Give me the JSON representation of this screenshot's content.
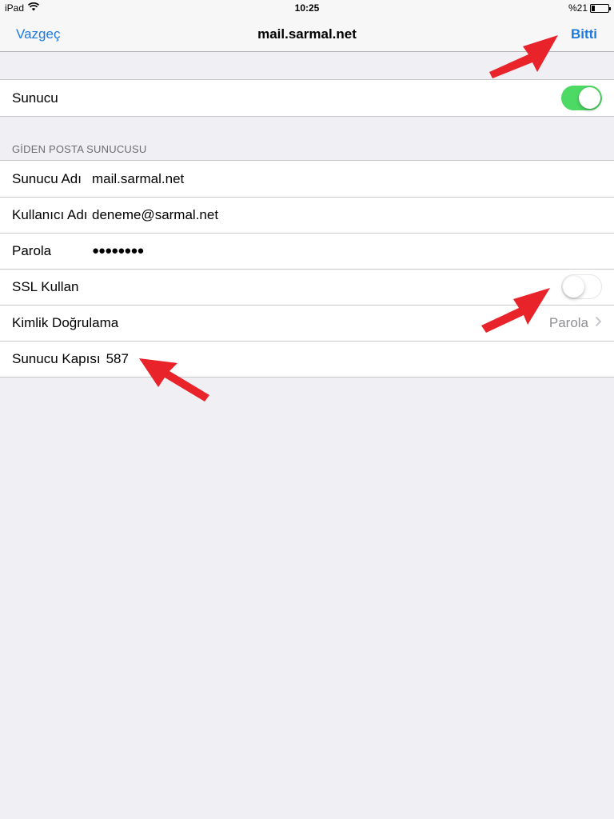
{
  "status_bar": {
    "device": "iPad",
    "time": "10:25",
    "battery_text": "%21",
    "battery_fraction": 0.21,
    "wifi_icon": "wifi-icon",
    "battery_icon": "battery-icon"
  },
  "nav": {
    "cancel_label": "Vazgeç",
    "title": "mail.sarmal.net",
    "done_label": "Bitti"
  },
  "server_group": {
    "server_label": "Sunucu",
    "server_enabled": true
  },
  "outgoing": {
    "section_header": "GİDEN POSTA SUNUCUSU",
    "rows": {
      "host": {
        "label": "Sunucu Adı",
        "value": "mail.sarmal.net"
      },
      "user": {
        "label": "Kullanıcı Adı",
        "value": "deneme@sarmal.net"
      },
      "password": {
        "label": "Parola",
        "value": "●●●●●●●●"
      },
      "ssl": {
        "label": "SSL Kullan",
        "enabled": false
      },
      "auth": {
        "label": "Kimlik Doğrulama",
        "value": "Parola"
      },
      "port": {
        "label": "Sunucu Kapısı",
        "value": "587"
      }
    }
  },
  "colors": {
    "accent": "#1a7ae0",
    "toggle_on": "#4cd964",
    "annotation_arrow": "#e8232a",
    "background": "#efeff4"
  }
}
